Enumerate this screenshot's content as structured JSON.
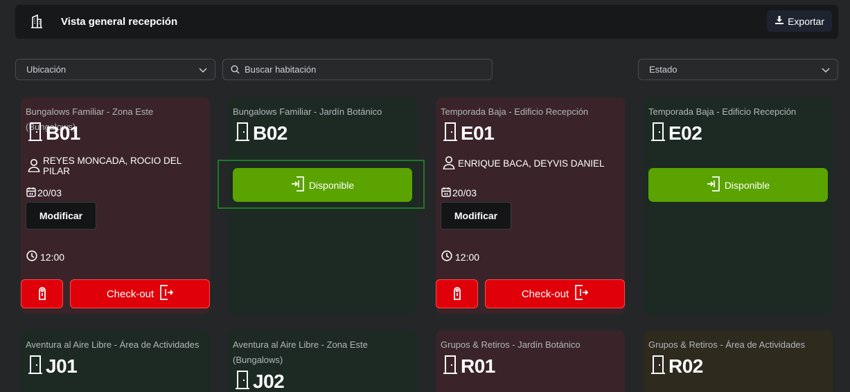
{
  "header": {
    "title": "Vista general recepción",
    "export_label": "Exportar"
  },
  "filters": {
    "location_label": "Ubicación",
    "search_placeholder": "Buscar habitación",
    "status_label": "Estado"
  },
  "actions": {
    "modify_label": "Modificar",
    "checkout_label": "Check-out",
    "available_label": "Disponible"
  },
  "colors": {
    "occupied_bg": "#3a2429",
    "free_bg": "#1c2a23",
    "available_green": "#5aa300",
    "checkout_red": "#e0000a"
  },
  "rooms": [
    {
      "location": "Bungalows Familiar - Zona Este (Bungalows)",
      "number": "B01",
      "status": "occupied",
      "guest": "REYES MONCADA, ROCIO DEL PILAR",
      "date": "20/03",
      "time": "12:00"
    },
    {
      "location": "Bungalows Familiar - Jardín Botánico",
      "number": "B02",
      "status": "available"
    },
    {
      "location": "Temporada Baja - Edificio Recepción",
      "number": "E01",
      "status": "occupied",
      "guest": "ENRIQUE BACA, DEYVIS DANIEL",
      "date": "20/03",
      "time": "12:00"
    },
    {
      "location": "Temporada Baja - Edificio Recepción",
      "number": "E02",
      "status": "available"
    },
    {
      "location": "Aventura al Aire Libre - Área de Actividades",
      "number": "J01",
      "status": "free"
    },
    {
      "location": "Aventura al Aire Libre - Zona Este (Bungalows)",
      "number": "J02",
      "status": "free"
    },
    {
      "location": "Grupos & Retiros - Jardín Botánico",
      "number": "R01",
      "status": "occupied"
    },
    {
      "location": "Grupos & Retiros - Área de Actividades",
      "number": "R02",
      "status": "pending"
    }
  ]
}
